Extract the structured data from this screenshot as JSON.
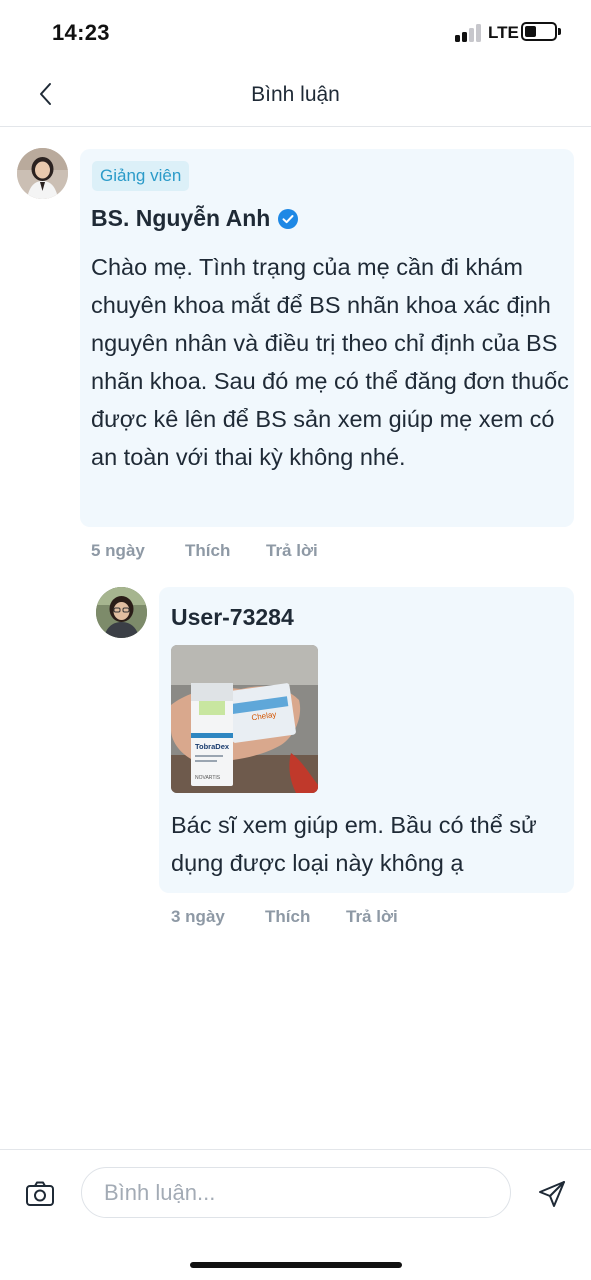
{
  "status_bar": {
    "time": "14:23",
    "network": "LTE",
    "battery_level": 0.35
  },
  "header": {
    "title": "Bình luận",
    "back_icon": "chevron-left-icon"
  },
  "comments": [
    {
      "badge": "Giảng viên",
      "author": "BS. Nguyễn Anh",
      "verified": true,
      "text": "Chào mẹ. Tình trạng của mẹ cần đi khám chuyên khoa mắt để BS nhãn khoa xác định nguyên nhân và điều trị theo chỉ định của BS nhãn khoa. Sau đó mẹ có thể đăng đơn thuốc được kê lên để BS sản xem giúp mẹ xem có an toàn với thai kỳ không nhé.",
      "time_ago": "5 ngày",
      "like_label": "Thích",
      "reply_label": "Trả lời"
    }
  ],
  "reply": {
    "author": "User-73284",
    "photo": {
      "box_brand": "TobraDex",
      "box_maker": "NOVARTIS",
      "strip_text": "Chelay"
    },
    "text": "Bác sĩ xem giúp em. Bầu có thể sử dụng được loại này không ạ",
    "time_ago": "3 ngày",
    "like_label": "Thích",
    "reply_label": "Trả lời"
  },
  "composer": {
    "placeholder": "Bình luận...",
    "camera_icon": "camera-icon",
    "send_icon": "send-icon"
  },
  "colors": {
    "accent": "#2b9bc9",
    "bubble_bg": "#f1f8fd",
    "badge_bg": "#dcf0f8",
    "verified": "#1e88e5",
    "meta_text": "#8e99a5"
  }
}
